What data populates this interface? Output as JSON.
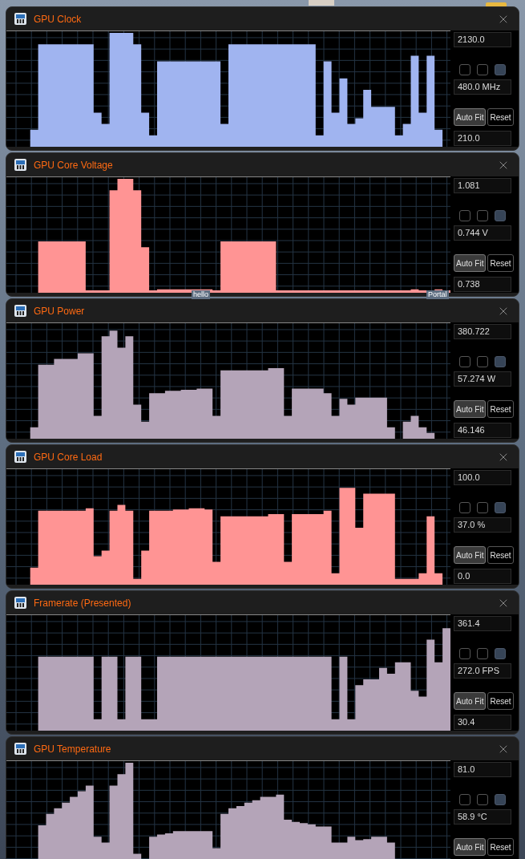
{
  "windows": [
    {
      "title": "GPU Clock",
      "color": "#a0b4f0",
      "max": "2130.0",
      "current": "480.0 MHz",
      "min": "210.0",
      "checkboxes": [
        {
          "checked": false
        },
        {
          "checked": false
        },
        {
          "checked": true
        }
      ],
      "auto_fit": {
        "label": "Auto Fit",
        "active": true
      },
      "reset": "Reset"
    },
    {
      "title": "GPU Core Voltage",
      "color": "#ff9494",
      "max": "1.081",
      "current": "0.744 V",
      "min": "0.738",
      "checkboxes": [
        {
          "checked": false
        },
        {
          "checked": false
        },
        {
          "checked": true
        }
      ],
      "auto_fit": {
        "label": "Auto Fit",
        "active": true
      },
      "reset": "Reset"
    },
    {
      "title": "GPU Power",
      "color": "#b4a4b8",
      "max": "380.722",
      "current": "57.274 W",
      "min": "46.146",
      "checkboxes": [
        {
          "checked": false
        },
        {
          "checked": false
        },
        {
          "checked": true
        }
      ],
      "auto_fit": {
        "label": "Auto Fit",
        "active": true
      },
      "reset": "Reset"
    },
    {
      "title": "GPU Core Load",
      "color": "#ff9494",
      "max": "100.0",
      "current": "37.0 %",
      "min": "0.0",
      "checkboxes": [
        {
          "checked": false
        },
        {
          "checked": false
        },
        {
          "checked": true
        }
      ],
      "auto_fit": {
        "label": "Auto Fit",
        "active": true
      },
      "reset": "Reset"
    },
    {
      "title": "Framerate (Presented)",
      "color": "#b4a4b8",
      "max": "361.4",
      "current": "272.0 FPS",
      "min": "30.4",
      "checkboxes": [
        {
          "checked": false
        },
        {
          "checked": false
        },
        {
          "checked": true
        }
      ],
      "auto_fit": {
        "label": "Auto Fit",
        "active": true
      },
      "reset": "Reset"
    },
    {
      "title": "GPU Temperature",
      "color": "#b4a4b8",
      "max": "81.0",
      "current": "58.9 °C",
      "checkboxes": [
        {
          "checked": false
        },
        {
          "checked": false
        },
        {
          "checked": true
        }
      ],
      "auto_fit": {
        "label": "Auto Fit",
        "active": true
      },
      "reset": "Reset"
    }
  ],
  "desktop_labels": [
    "hello",
    "Portal"
  ]
}
